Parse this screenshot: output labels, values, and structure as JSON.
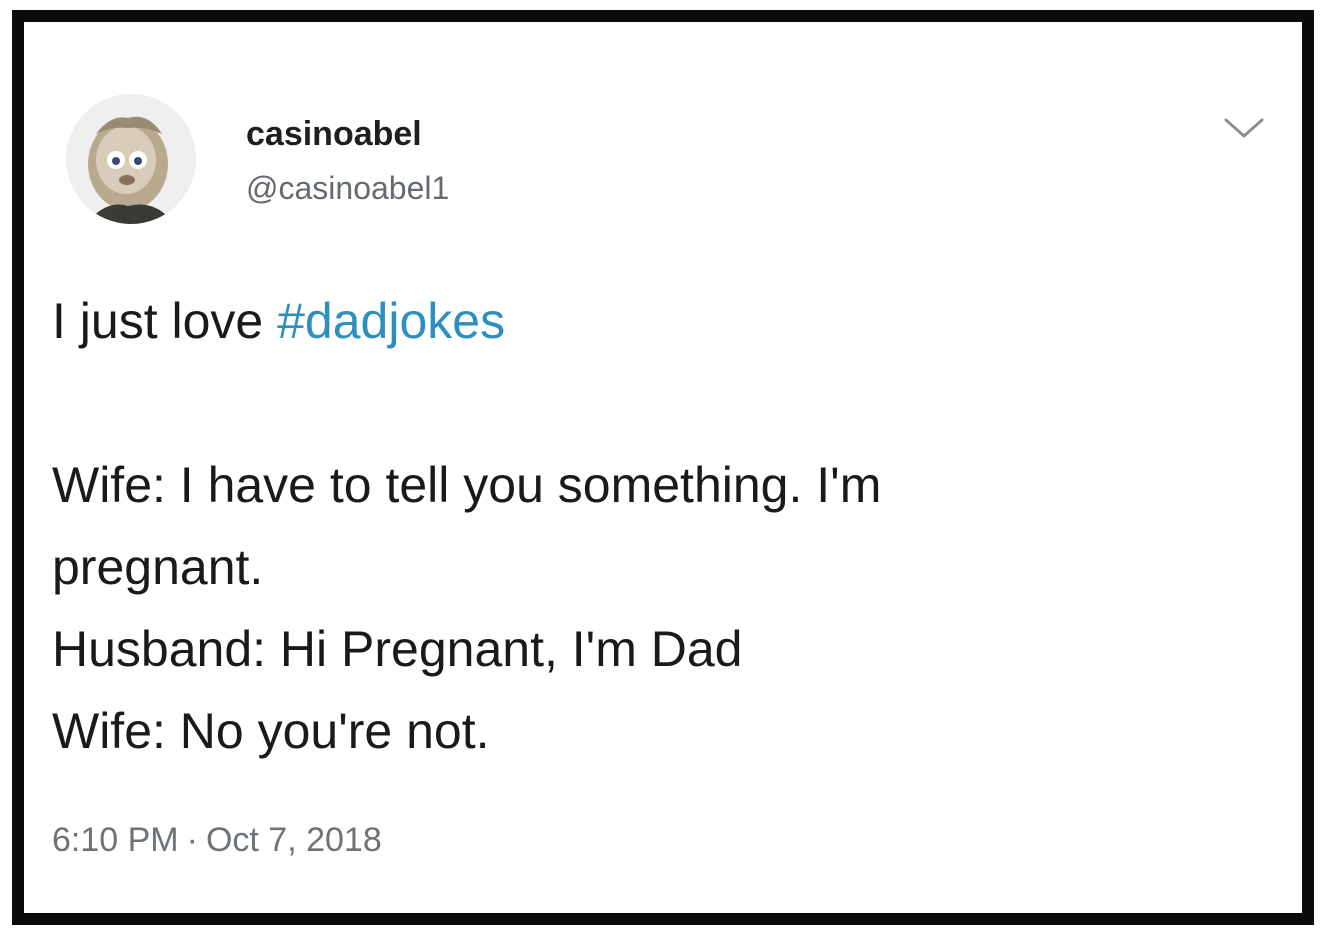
{
  "tweet": {
    "author": {
      "display_name": "casinoabel",
      "handle": "@casinoabel1"
    },
    "menu_icon": "chevron-down-icon",
    "text": {
      "intro_prefix": "I just love ",
      "hashtag": "#dadjokes",
      "lines": [
        "Wife: I have to tell you something. I'm",
        "pregnant.",
        "Husband: Hi Pregnant, I'm Dad",
        "Wife: No you're not."
      ]
    },
    "time": "6:10 PM",
    "separator": "·",
    "date": "Oct 7, 2018"
  },
  "colors": {
    "hashtag": "#2d8fbf",
    "border": "#0a0a0a",
    "meta_text": "#6e7378"
  }
}
